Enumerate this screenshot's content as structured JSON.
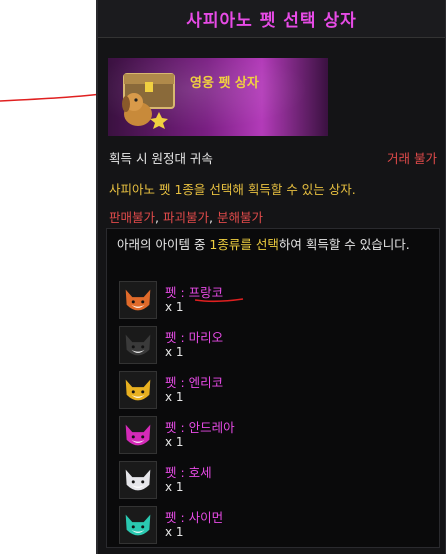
{
  "tooltip": {
    "title": "사피아노 펫 선택 상자",
    "item_name": "영웅 펫 상자",
    "acquire_text": "획득 시 원정대 귀속",
    "trade_status": "거래 불가",
    "description": "사피아노 펫 1종을 선택해 획득할 수 있는 상자.",
    "restrictions": [
      "판매불가",
      "파괴불가",
      "분해불가"
    ],
    "restriction_separator": ", ",
    "selection_prefix": "아래의 아이템 중 ",
    "selection_highlight": "1종류를 선택",
    "selection_suffix": "하여 획득할 수 있습니다.",
    "pets": [
      {
        "name": "펫 : 프랑코",
        "qty": "x 1",
        "color": "#e06a2a"
      },
      {
        "name": "펫 : 마리오",
        "qty": "x 1",
        "color": "#3a3a3a"
      },
      {
        "name": "펫 : 엔리코",
        "qty": "x 1",
        "color": "#e8b020"
      },
      {
        "name": "펫 : 안드레아",
        "qty": "x 1",
        "color": "#d42ab8"
      },
      {
        "name": "펫 : 호세",
        "qty": "x 1",
        "color": "#e6e6ea"
      },
      {
        "name": "펫 : 사이먼",
        "qty": "x 1",
        "color": "#2ac8b0"
      }
    ]
  },
  "colors": {
    "title": "#e74be6",
    "gold": "#f0d040",
    "warning": "#e04a4a",
    "annotation": "#e02020"
  }
}
